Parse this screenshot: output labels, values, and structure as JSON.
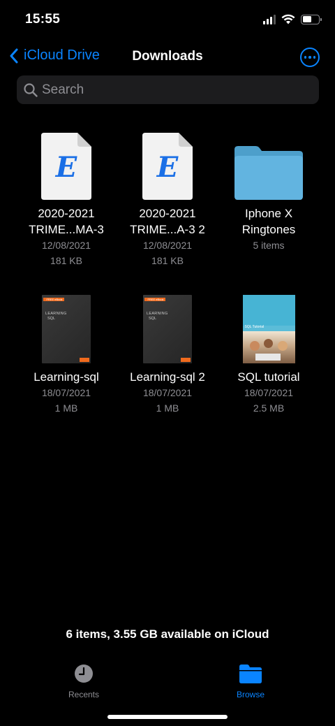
{
  "status": {
    "time": "15:55"
  },
  "nav": {
    "back_label": "iCloud Drive",
    "title": "Downloads"
  },
  "search": {
    "placeholder": "Search"
  },
  "files": [
    {
      "name_line1": "2020-2021",
      "name_line2": "TRIME...MA-3",
      "date": "12/08/2021",
      "size": "181 KB",
      "icon": "document-icon",
      "icon_letter": "E"
    },
    {
      "name_line1": "2020-2021",
      "name_line2": "TRIME...A-3 2",
      "date": "12/08/2021",
      "size": "181 KB",
      "icon": "document-icon",
      "icon_letter": "E"
    },
    {
      "name_line1": "Iphone X",
      "name_line2": "Ringtones",
      "date": "",
      "size": "5 items",
      "icon": "folder-icon"
    },
    {
      "name_line1": "Learning-sql",
      "date": "18/07/2021",
      "size": "1 MB",
      "icon": "book-thumbnail",
      "cover_title_1": "LEARNING",
      "cover_title_2": "SQL",
      "cover_badge": "FREE eBook"
    },
    {
      "name_line1": "Learning-sql 2",
      "date": "18/07/2021",
      "size": "1 MB",
      "icon": "book-thumbnail",
      "cover_title_1": "LEARNING",
      "cover_title_2": "SQL",
      "cover_badge": "FREE eBook"
    },
    {
      "name_line1": "SQL tutorial",
      "date": "18/07/2021",
      "size": "2.5 MB",
      "icon": "sql-tutorial-thumbnail",
      "cover_label": "SQL Tutorial"
    }
  ],
  "footer": {
    "info": "6 items, 3.55 GB available on iCloud"
  },
  "tabs": [
    {
      "label": "Recents",
      "icon": "clock-icon"
    },
    {
      "label": "Browse",
      "icon": "folder-icon"
    }
  ],
  "colors": {
    "accent": "#0a84ff",
    "background": "#000000",
    "secondary_text": "#8e8e93",
    "folder": "#5fb0dc"
  }
}
